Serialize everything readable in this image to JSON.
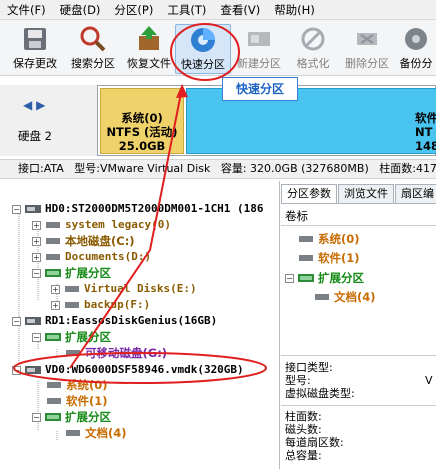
{
  "menu": [
    "文件(F)",
    "硬盘(D)",
    "分区(P)",
    "工具(T)",
    "查看(V)",
    "帮助(H)"
  ],
  "toolbar": {
    "save": "保存更改",
    "search": "搜索分区",
    "restore": "恢复文件",
    "quick": "快速分区",
    "new": "新建分区",
    "format": "格式化",
    "delete": "删除分区",
    "backup": "备份分"
  },
  "tooltip": "快速分区",
  "diskbar": {
    "disk_label": "硬盘 2",
    "seg1": {
      "name": "系统(0)",
      "fs": "NTFS (活动)",
      "size": "25.0GB"
    },
    "seg2": {
      "name": "软件",
      "fs": "NT",
      "size": "148."
    }
  },
  "infobar": {
    "iface": "接口:ATA",
    "model": "型号:VMware Virtual Disk",
    "capacity": "容量: 320.0GB (327680MB)",
    "cyl": "柱面数:417"
  },
  "tree": {
    "hd0": "HD0:ST2000DM5T2000DM001-1CH1 (186",
    "hd0_items": [
      "system legacy(0)",
      "本地磁盘(C:)",
      "Documents(D:)",
      "扩展分区",
      "Virtual Disks(E:)",
      "backup(F:)"
    ],
    "rd1": "RD1:EassosDiskGenius(16GB)",
    "rd1_items": [
      "扩展分区",
      "可移动磁盘(G:)"
    ],
    "vd0": "VD0:WD6000DSF58946.vmdk(320GB)",
    "vd0_items": [
      "系统(0)",
      "软件(1)",
      "扩展分区",
      "文档(4)"
    ]
  },
  "right": {
    "tabs": [
      "分区参数",
      "浏览文件",
      "扇区编"
    ],
    "header": "卷标",
    "items": [
      "系统(0)",
      "软件(1)",
      "扩展分区",
      "文档(4)"
    ],
    "props1": [
      "接口类型:",
      "型号:",
      "虚拟磁盘类型:"
    ],
    "props1_val": "V",
    "props2": [
      "柱面数:",
      "磁头数:",
      "每道扇区数:",
      "总容量:"
    ]
  }
}
